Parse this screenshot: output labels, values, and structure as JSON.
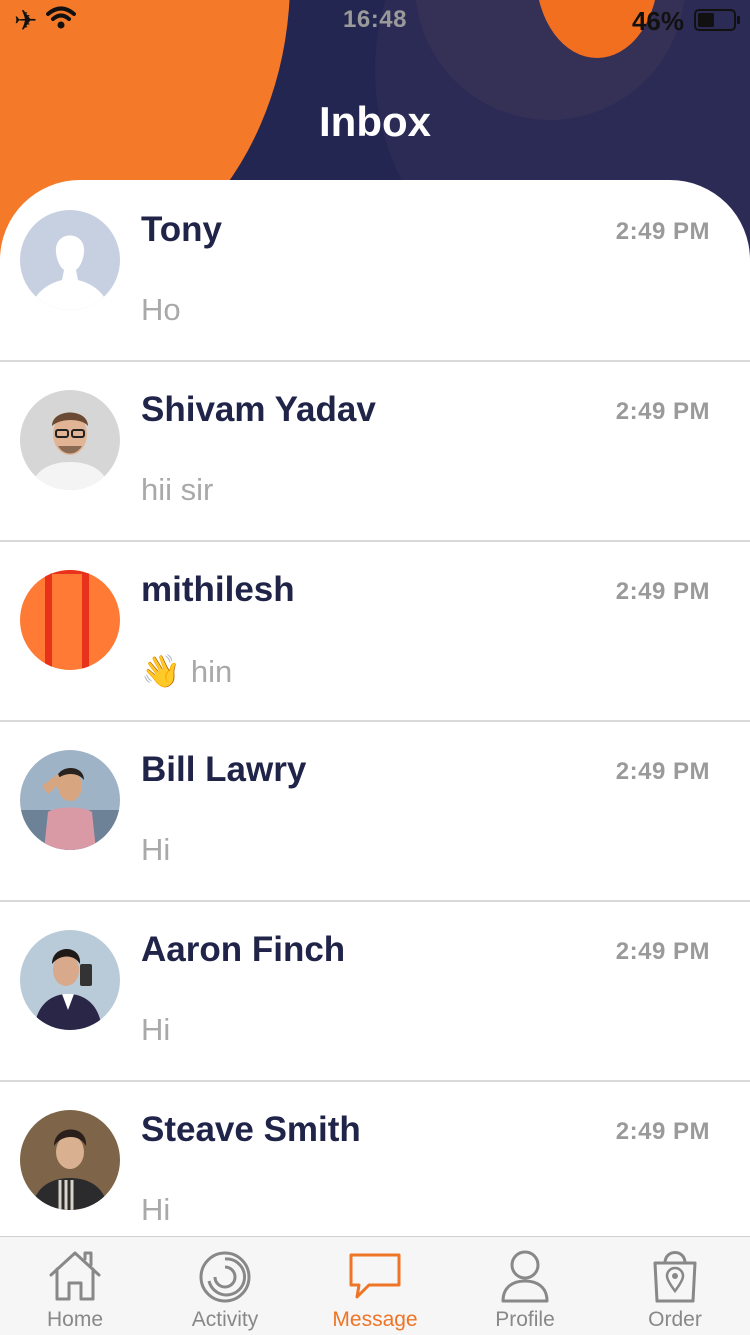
{
  "status": {
    "time": "16:48",
    "battery": "46%",
    "battery_fraction": 0.46
  },
  "header": {
    "title": "Inbox"
  },
  "conversations": [
    {
      "name": "Tony",
      "time": "2:49 PM",
      "message": "Ho",
      "avatar": "default-avatar"
    },
    {
      "name": "Shivam Yadav",
      "time": "2:49 PM",
      "message": "hii sir",
      "avatar": "photo-avatar"
    },
    {
      "name": "mithilesh",
      "time": "2:49 PM",
      "message": "hin",
      "emoji": "👋",
      "avatar": "orange-avatar"
    },
    {
      "name": "Bill Lawry",
      "time": "2:49 PM",
      "message": "Hi",
      "avatar": "photo-avatar"
    },
    {
      "name": "Aaron Finch",
      "time": "2:49 PM",
      "message": "Hi",
      "avatar": "photo-avatar"
    },
    {
      "name": "Steave Smith",
      "time": "2:49 PM",
      "message": "Hi",
      "avatar": "photo-avatar"
    }
  ],
  "tabs": [
    {
      "label": "Home",
      "icon": "home-icon"
    },
    {
      "label": "Activity",
      "icon": "activity-icon"
    },
    {
      "label": "Message",
      "icon": "message-icon",
      "active": true
    },
    {
      "label": "Profile",
      "icon": "profile-icon"
    },
    {
      "label": "Order",
      "icon": "order-icon"
    }
  ],
  "colors": {
    "accent": "#ee7426",
    "header_bg": "#232650",
    "name_text": "#202449"
  }
}
